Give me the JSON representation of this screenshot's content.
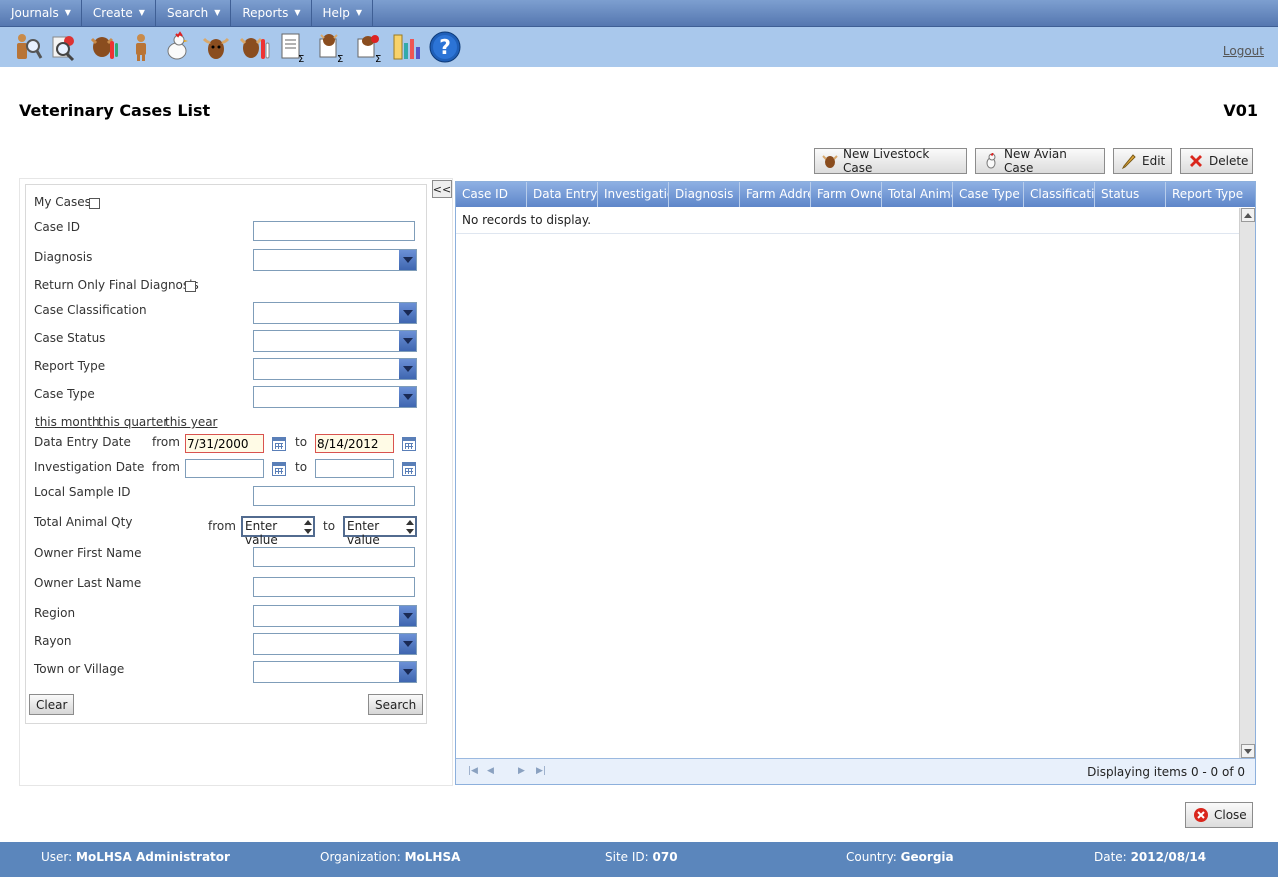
{
  "menu": [
    {
      "label": "Journals"
    },
    {
      "label": "Create"
    },
    {
      "label": "Search"
    },
    {
      "label": "Reports"
    },
    {
      "label": "Help"
    }
  ],
  "toolbar": {
    "icons": [
      "person-search-icon",
      "person-inspect-icon",
      "livestock-sample-icon",
      "person-icon",
      "chicken-icon",
      "cow-icon",
      "livestock-tube-icon",
      "report-sum-icon",
      "livestock-report-sum-icon",
      "avian-report-sum-icon",
      "statistics-icon",
      "help-icon"
    ],
    "logout": "Logout"
  },
  "page": {
    "title": "Veterinary Cases List",
    "code": "V01"
  },
  "actions": {
    "new_livestock": "New Livestock Case",
    "new_avian": "New Avian Case",
    "edit": "Edit",
    "delete": "Delete",
    "close": "Close"
  },
  "filters": {
    "my_cases": "My Cases",
    "case_id": "Case ID",
    "diagnosis": "Diagnosis",
    "final_diagnosis": "Return Only Final Diagnosis",
    "classification": "Case Classification",
    "status": "Case Status",
    "report_type": "Report Type",
    "case_type": "Case Type",
    "this_month": "this month",
    "this_quarter": "this quarter",
    "this_year": "this year",
    "data_entry_date": "Data Entry Date",
    "investigation_date": "Investigation Date",
    "from": "from",
    "to": "to",
    "entry_from_value": "7/31/2000",
    "entry_to_value": "8/14/2012",
    "local_sample_id": "Local Sample ID",
    "total_animal_qty": "Total Animal Qty",
    "qty_placeholder": "Enter value",
    "owner_first": "Owner First Name",
    "owner_last": "Owner Last Name",
    "region": "Region",
    "rayon": "Rayon",
    "town": "Town or Village",
    "clear": "Clear",
    "search": "Search",
    "collapse": "<<"
  },
  "grid": {
    "columns": [
      "Case ID",
      "Data Entry Date",
      "Investigation Date",
      "Diagnosis",
      "Farm Address",
      "Farm Owner",
      "Total Animal Qty",
      "Case Type",
      "Classification",
      "Status",
      "Report Type"
    ],
    "empty": "No records to display.",
    "pager_info": "Displaying items 0 - 0 of 0"
  },
  "footer": {
    "user_label": "User:",
    "user": "MoLHSA Administrator",
    "org_label": "Organization:",
    "org": "MoLHSA",
    "site_label": "Site ID:",
    "site": "070",
    "country_label": "Country:",
    "country": "Georgia",
    "date_label": "Date:",
    "date": "2012/08/14"
  }
}
